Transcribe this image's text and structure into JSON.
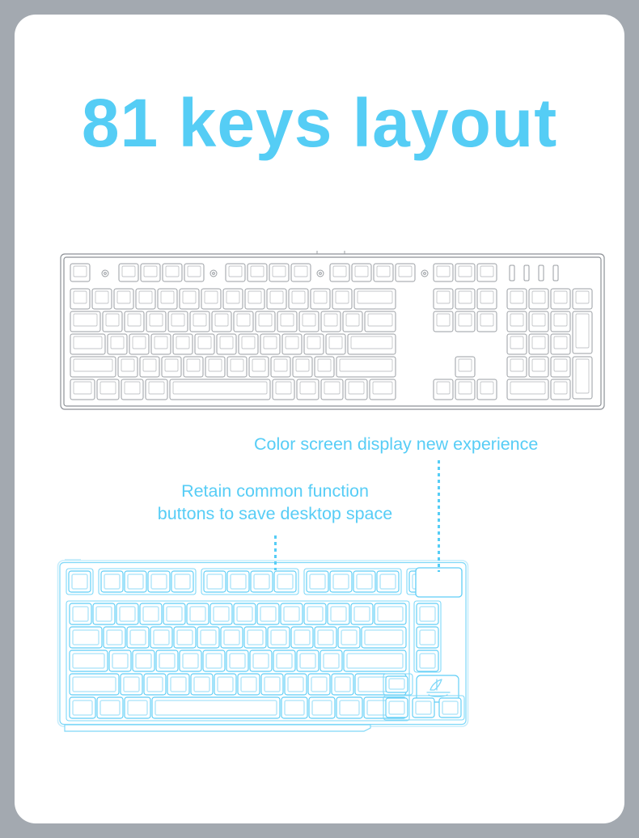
{
  "page": {
    "background_color": "#a3a9b0",
    "card_color": "#ffffff",
    "accent_color": "#55cdf5",
    "outline_gray": "#8d9196"
  },
  "header": {
    "title": "81 keys layout"
  },
  "captions": {
    "screen": "Color screen display new experience",
    "function_line1": "Retain common function",
    "function_line2": "buttons to save desktop space"
  },
  "keyboards": {
    "full_size": {
      "name": "full-size-keyboard-diagram",
      "style": "gray-outline",
      "indicator_leds": 4,
      "marker_dots": 4,
      "rows": 6,
      "has_numpad": true,
      "has_arrow_cluster": true
    },
    "compact_81": {
      "name": "81-key-keyboard-diagram",
      "style": "cyan-outline",
      "key_count": 81,
      "has_display_screen": true,
      "display_screen_label": "color-screen",
      "logo_key_label": "sailboat-logo-key",
      "function_row_groups": [
        1,
        4,
        4,
        4,
        1
      ],
      "has_arrow_cluster": true,
      "right_column_keys": 3
    }
  }
}
